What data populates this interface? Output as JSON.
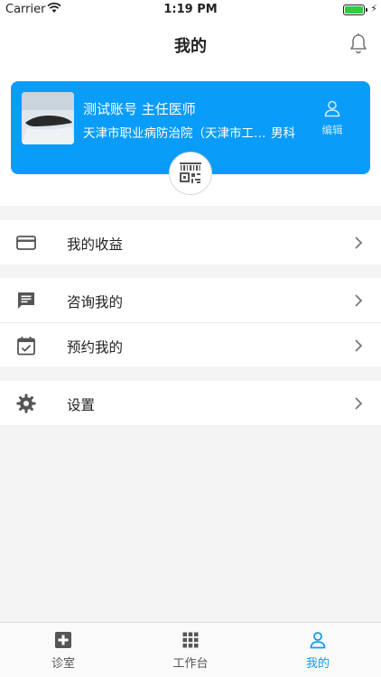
{
  "status_bar": {
    "carrier": "Carrier",
    "time": "1:19 PM"
  },
  "nav": {
    "title": "我的",
    "bell_icon": "bell-icon"
  },
  "profile": {
    "name_line": "测试账号 主任医师",
    "hospital": "天津市职业病防治院（天津市工人医院）",
    "department": "男科",
    "edit_label": "编辑",
    "qr_icon": "qr-code-icon",
    "accent_color": "#0a9cf9"
  },
  "menu": {
    "earnings": {
      "label": "我的收益",
      "icon": "card-icon"
    },
    "consult": {
      "label": "咨询我的",
      "icon": "chat-icon"
    },
    "appointment": {
      "label": "预约我的",
      "icon": "calendar-check-icon"
    },
    "settings": {
      "label": "设置",
      "icon": "gear-icon"
    }
  },
  "tabs": [
    {
      "label": "诊室",
      "icon": "clinic-plus-icon",
      "active": false
    },
    {
      "label": "工作台",
      "icon": "grid-icon",
      "active": false
    },
    {
      "label": "我的",
      "icon": "person-icon",
      "active": true
    }
  ]
}
